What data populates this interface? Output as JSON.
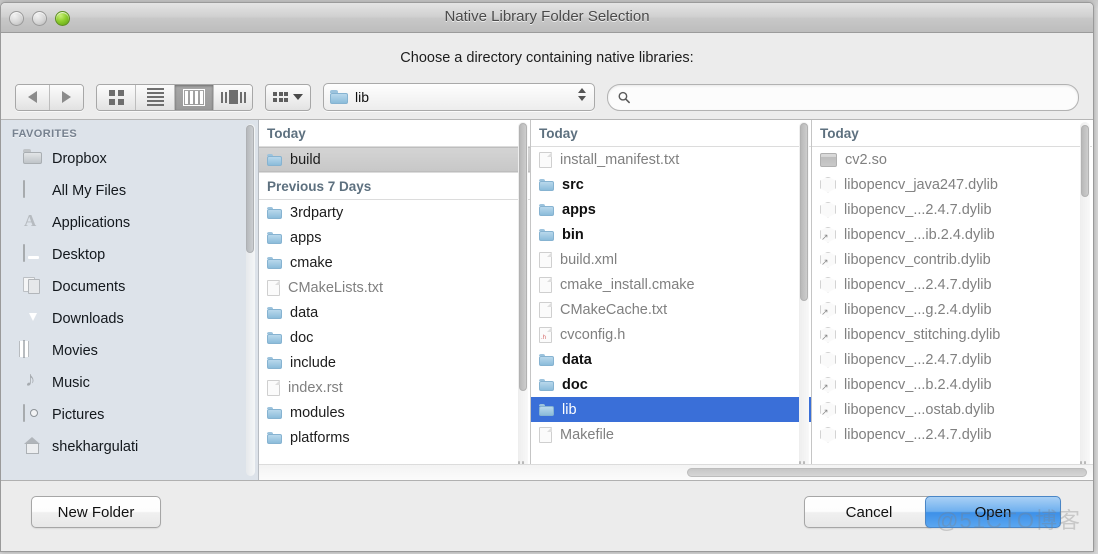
{
  "window": {
    "title": "Native Library Folder Selection",
    "prompt": "Choose a directory containing native libraries:",
    "traffic": {
      "close": "close-button",
      "minimize": "minimize-button",
      "zoom": "zoom-button"
    }
  },
  "background_window": {
    "text_left": "",
    "text_mid": "",
    "text_right": ""
  },
  "toolbar": {
    "back_icon": "back-arrow-icon",
    "forward_icon": "forward-arrow-icon",
    "view_modes": [
      {
        "name": "icon-view",
        "active": false
      },
      {
        "name": "list-view",
        "active": false
      },
      {
        "name": "column-view",
        "active": true
      },
      {
        "name": "coverflow-view",
        "active": false
      }
    ],
    "action_menu_label": "",
    "path_popup": {
      "label": "lib",
      "icon": "folder-icon"
    },
    "search": {
      "value": "",
      "placeholder": "",
      "icon": "search-icon"
    }
  },
  "sidebar": {
    "header": "FAVORITES",
    "items": [
      {
        "label": "Dropbox",
        "icon": "folder-icon"
      },
      {
        "label": "All My Files",
        "icon": "all-my-files-icon"
      },
      {
        "label": "Applications",
        "icon": "applications-icon"
      },
      {
        "label": "Desktop",
        "icon": "desktop-icon"
      },
      {
        "label": "Documents",
        "icon": "documents-icon"
      },
      {
        "label": "Downloads",
        "icon": "downloads-icon"
      },
      {
        "label": "Movies",
        "icon": "movies-icon"
      },
      {
        "label": "Music",
        "icon": "music-icon"
      },
      {
        "label": "Pictures",
        "icon": "pictures-icon"
      },
      {
        "label": "shekhargulati",
        "icon": "home-icon"
      }
    ]
  },
  "columns": [
    {
      "name": "column-1",
      "groups": [
        {
          "header": "Today",
          "items": [
            {
              "label": "build",
              "icon": "folder-icon",
              "kind": "folder",
              "selected": true
            }
          ]
        },
        {
          "header": "Previous 7 Days",
          "items": [
            {
              "label": "3rdparty",
              "icon": "folder-icon",
              "kind": "folder"
            },
            {
              "label": "apps",
              "icon": "folder-icon",
              "kind": "folder"
            },
            {
              "label": "cmake",
              "icon": "folder-icon",
              "kind": "folder"
            },
            {
              "label": "CMakeLists.txt",
              "icon": "document-icon",
              "kind": "file"
            },
            {
              "label": "data",
              "icon": "folder-icon",
              "kind": "folder"
            },
            {
              "label": "doc",
              "icon": "folder-icon",
              "kind": "folder"
            },
            {
              "label": "include",
              "icon": "folder-icon",
              "kind": "folder"
            },
            {
              "label": "index.rst",
              "icon": "document-icon",
              "kind": "file"
            },
            {
              "label": "modules",
              "icon": "folder-icon",
              "kind": "folder"
            },
            {
              "label": "platforms",
              "icon": "folder-icon",
              "kind": "folder"
            }
          ]
        }
      ]
    },
    {
      "name": "column-2",
      "groups": [
        {
          "header": "Today",
          "items": [
            {
              "label": "install_manifest.txt",
              "icon": "document-icon",
              "kind": "file"
            },
            {
              "label": "src",
              "icon": "folder-icon",
              "kind": "folder"
            },
            {
              "label": "apps",
              "icon": "folder-icon",
              "kind": "folder"
            },
            {
              "label": "bin",
              "icon": "folder-icon",
              "kind": "folder"
            },
            {
              "label": "build.xml",
              "icon": "document-icon",
              "kind": "file"
            },
            {
              "label": "cmake_install.cmake",
              "icon": "document-icon",
              "kind": "file"
            },
            {
              "label": "CMakeCache.txt",
              "icon": "document-icon",
              "kind": "file"
            },
            {
              "label": "cvconfig.h",
              "icon": "header-file-icon",
              "kind": "file",
              "ext": ".h"
            },
            {
              "label": "data",
              "icon": "folder-icon",
              "kind": "folder"
            },
            {
              "label": "doc",
              "icon": "folder-icon",
              "kind": "folder"
            },
            {
              "label": "lib",
              "icon": "folder-icon",
              "kind": "folder",
              "selected": true
            },
            {
              "label": "Makefile",
              "icon": "document-icon",
              "kind": "file"
            }
          ]
        }
      ]
    },
    {
      "name": "column-3",
      "groups": [
        {
          "header": "Today",
          "items": [
            {
              "label": "cv2.so",
              "icon": "binary-icon",
              "kind": "binary"
            },
            {
              "label": "libopencv_java247.dylib",
              "icon": "dylib-icon",
              "kind": "dylib"
            },
            {
              "label": "libopencv_...2.4.7.dylib",
              "icon": "dylib-icon",
              "kind": "dylib"
            },
            {
              "label": "libopencv_...ib.2.4.dylib",
              "icon": "dylib-alias-icon",
              "kind": "dylib-alias"
            },
            {
              "label": "libopencv_contrib.dylib",
              "icon": "dylib-alias-icon",
              "kind": "dylib-alias"
            },
            {
              "label": "libopencv_...2.4.7.dylib",
              "icon": "dylib-icon",
              "kind": "dylib"
            },
            {
              "label": "libopencv_...g.2.4.dylib",
              "icon": "dylib-alias-icon",
              "kind": "dylib-alias"
            },
            {
              "label": "libopencv_stitching.dylib",
              "icon": "dylib-alias-icon",
              "kind": "dylib-alias"
            },
            {
              "label": "libopencv_...2.4.7.dylib",
              "icon": "dylib-icon",
              "kind": "dylib"
            },
            {
              "label": "libopencv_...b.2.4.dylib",
              "icon": "dylib-alias-icon",
              "kind": "dylib-alias"
            },
            {
              "label": "libopencv_...ostab.dylib",
              "icon": "dylib-alias-icon",
              "kind": "dylib-alias"
            },
            {
              "label": "libopencv_...2.4.7.dylib",
              "icon": "dylib-icon",
              "kind": "dylib"
            }
          ]
        }
      ]
    }
  ],
  "footer": {
    "new_folder": "New Folder",
    "cancel": "Cancel",
    "open": "Open"
  },
  "watermark": "@51CTO博客",
  "colors": {
    "selection_blue": "#3a6fd8",
    "default_button_blue": "#3d90e8",
    "sidebar_bg": "#dde3ea",
    "window_bg": "#ececec"
  }
}
